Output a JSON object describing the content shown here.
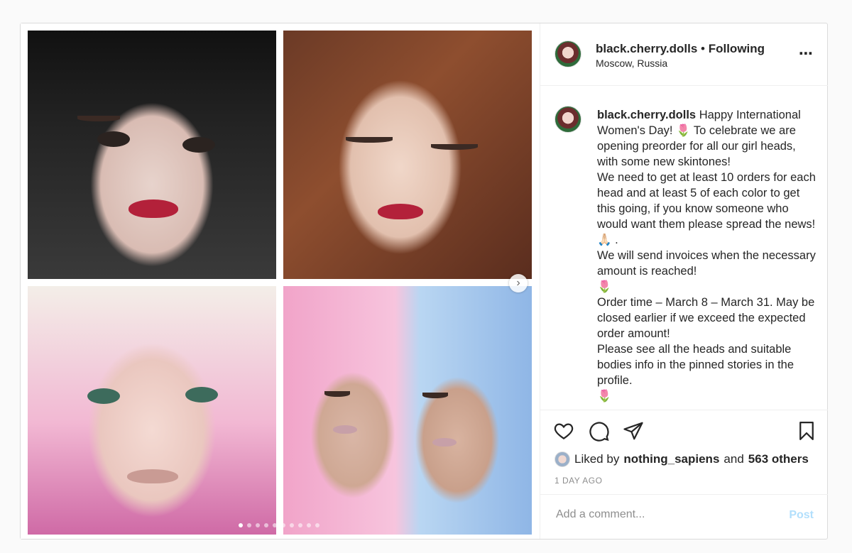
{
  "header": {
    "username": "black.cherry.dolls",
    "separator": " • ",
    "follow_status": "Following",
    "location": "Moscow, Russia",
    "more_icon": "⋯"
  },
  "caption": {
    "username": "black.cherry.dolls",
    "lines": [
      "Happy International Women's Day! 🌷 To celebrate we are opening preorder for all our girl heads, with some new skintones!",
      "We need to get at least 10 orders for each head and at least 5 of each color to get this going, if you know someone who would want them please spread the news!🙏🏻 .",
      "We will send invoices when the necessary amount is reached!",
      "🌷",
      "Order time – March 8 – March 31. May be closed earlier if we exceed the expected order amount!",
      "Please see all the heads and suitable bodies info in the pinned stories in the profile.",
      "🌷"
    ]
  },
  "likes": {
    "prefix": "Liked by",
    "user": "nothing_sapiens",
    "connector": "and",
    "others": "563 others"
  },
  "timestamp": "1 DAY AGO",
  "comment": {
    "placeholder": "Add a comment...",
    "post_label": "Post"
  },
  "carousel": {
    "next_icon": "›",
    "dot_count": 10,
    "active_index": 0
  },
  "colors": {
    "post_button_disabled": "#b2dffc",
    "muted_text": "#8e8e8e",
    "border": "#dbdbdb"
  }
}
